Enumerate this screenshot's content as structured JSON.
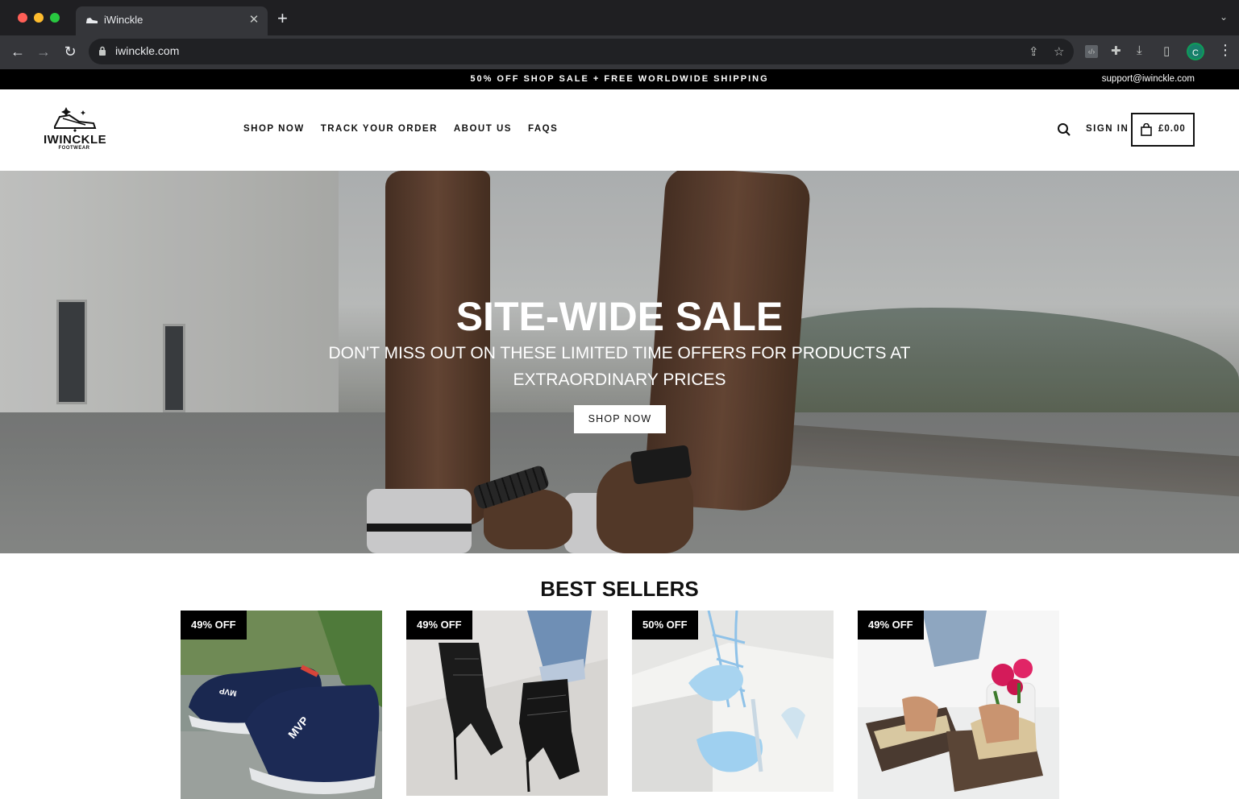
{
  "browser": {
    "tab_title": "iWinckle",
    "url": "iwinckle.com",
    "new_tab": "+",
    "tab_close": "✕",
    "profile_initial": "C"
  },
  "announcement": {
    "text": "50% OFF SHOP SALE + FREE WORLDWIDE SHIPPING",
    "email": "support@iwinckle.com"
  },
  "header": {
    "logo_brand": "IWINCKLE",
    "logo_sub": "FOOTWEAR",
    "nav": [
      "SHOP NOW",
      "TRACK YOUR ORDER",
      "ABOUT US",
      "FAQS"
    ],
    "sign_in": "SIGN IN",
    "cart_total": "£0.00"
  },
  "hero": {
    "title": "SITE-WIDE SALE",
    "subtitle": "DON'T MISS OUT ON THESE LIMITED TIME OFFERS FOR PRODUCTS AT EXTRAORDINARY PRICES",
    "button": "SHOP NOW"
  },
  "best_sellers": {
    "title": "BEST SELLERS",
    "products": [
      {
        "badge": "49% OFF",
        "image": "navy-slip-on-sneakers-image"
      },
      {
        "badge": "49% OFF",
        "image": "black-mesh-heel-boots-image"
      },
      {
        "badge": "50% OFF",
        "image": "blue-lace-up-heels-image"
      },
      {
        "badge": "49% OFF",
        "image": "gold-slide-sandals-image"
      }
    ]
  },
  "colors": {
    "announcement_bg": "#000000",
    "accent": "#111111",
    "badge_bg": "#000000"
  }
}
